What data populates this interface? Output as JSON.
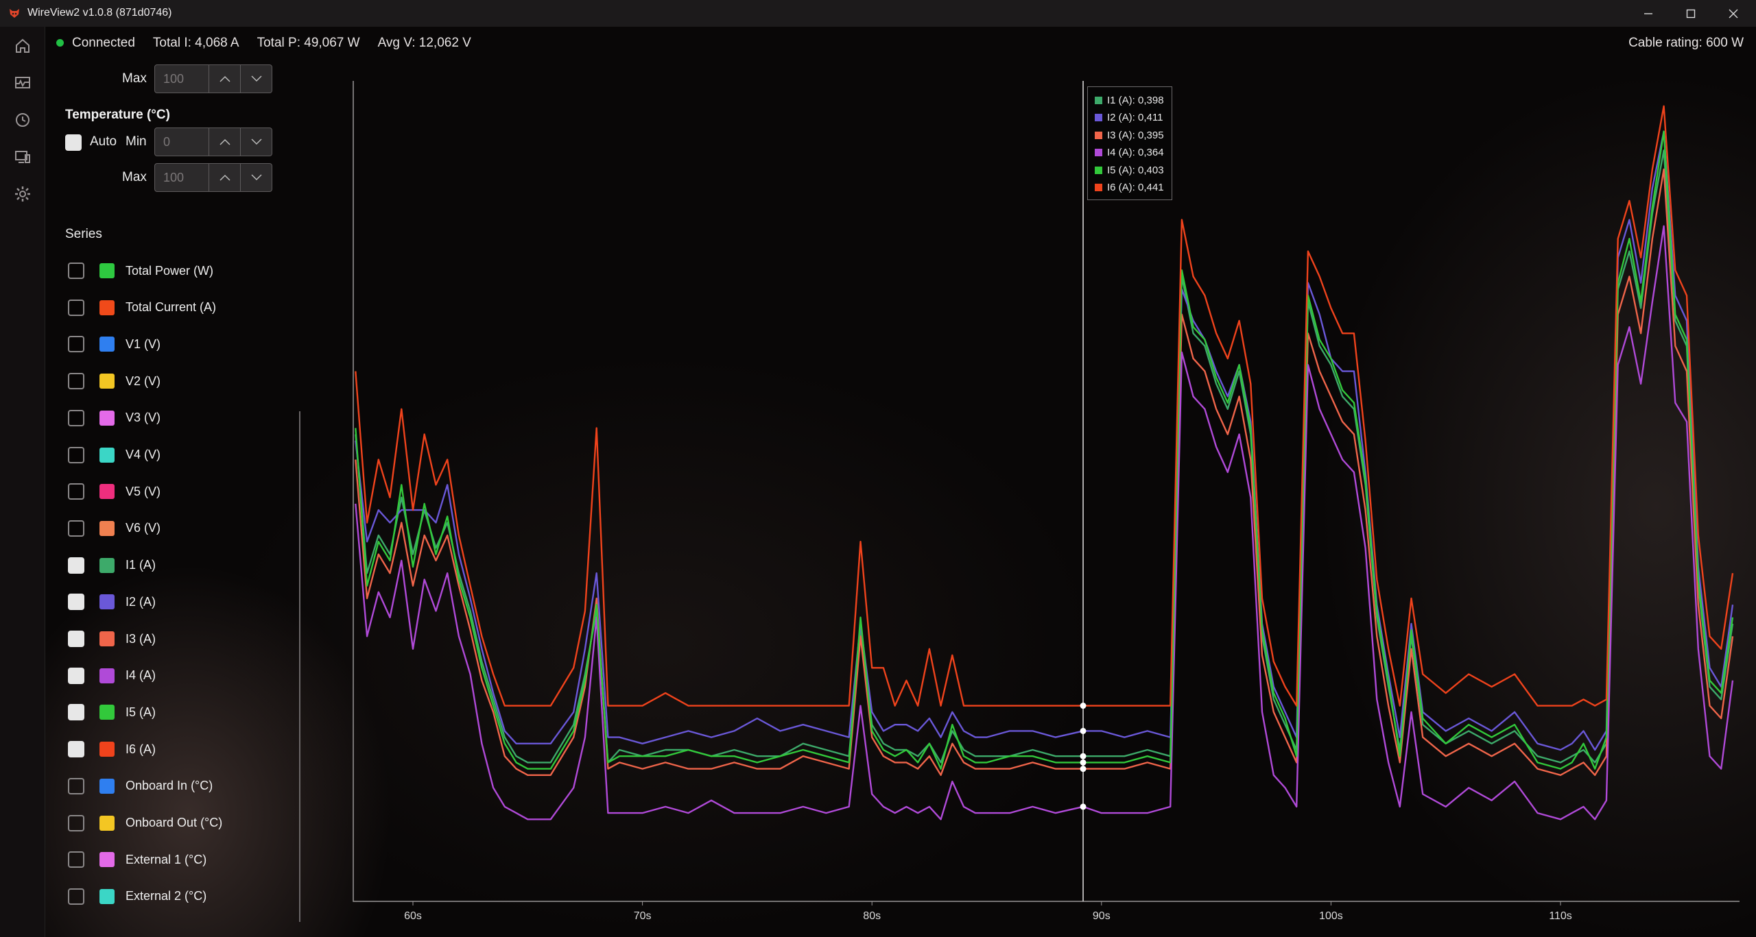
{
  "window": {
    "title": "WireView2 v1.0.8 (871d0746)"
  },
  "status": {
    "connection": "Connected",
    "total_current": "Total I: 4,068 A",
    "total_power": "Total P: 49,067 W",
    "avg_voltage": "Avg V: 12,062 V",
    "cable_rating": "Cable rating: 600 W"
  },
  "axis_controls": {
    "top_max_label": "Max",
    "top_max_value": "100",
    "temperature_title": "Temperature (°C)",
    "auto_label": "Auto",
    "min_label": "Min",
    "min_value": "0",
    "max_label": "Max",
    "max_value": "100"
  },
  "series_panel": {
    "title": "Series",
    "items": [
      {
        "label": "Total Power (W)",
        "color": "#2ec940",
        "checked": false
      },
      {
        "label": "Total Current (A)",
        "color": "#f04a1a",
        "checked": false
      },
      {
        "label": "V1 (V)",
        "color": "#2f7ff0",
        "checked": false
      },
      {
        "label": "V2 (V)",
        "color": "#f3c623",
        "checked": false
      },
      {
        "label": "V3 (V)",
        "color": "#e36ae8",
        "checked": false
      },
      {
        "label": "V4 (V)",
        "color": "#3bd6c6",
        "checked": false
      },
      {
        "label": "V5 (V)",
        "color": "#ef2e7e",
        "checked": false
      },
      {
        "label": "V6 (V)",
        "color": "#f08050",
        "checked": false
      },
      {
        "label": "I1 (A)",
        "color": "#3daa6a",
        "checked": true
      },
      {
        "label": "I2 (A)",
        "color": "#6a58d8",
        "checked": true
      },
      {
        "label": "I3 (A)",
        "color": "#f0654a",
        "checked": true
      },
      {
        "label": "I4 (A)",
        "color": "#b04ad8",
        "checked": true
      },
      {
        "label": "I5 (A)",
        "color": "#32c93b",
        "checked": true
      },
      {
        "label": "I6 (A)",
        "color": "#f0431c",
        "checked": true
      },
      {
        "label": "Onboard In (°C)",
        "color": "#2f7ff0",
        "checked": false
      },
      {
        "label": "Onboard Out (°C)",
        "color": "#f3c623",
        "checked": false
      },
      {
        "label": "External 1 (°C)",
        "color": "#e36ae8",
        "checked": false
      },
      {
        "label": "External 2 (°C)",
        "color": "#3bd6c6",
        "checked": false
      }
    ]
  },
  "tooltip": {
    "rows": [
      {
        "label": "I1 (A): 0,398",
        "color": "#3daa6a"
      },
      {
        "label": "I2 (A): 0,411",
        "color": "#6a58d8"
      },
      {
        "label": "I3 (A): 0,395",
        "color": "#f0654a"
      },
      {
        "label": "I4 (A): 0,364",
        "color": "#b04ad8"
      },
      {
        "label": "I5 (A): 0,403",
        "color": "#32c93b"
      },
      {
        "label": "I6 (A): 0,441",
        "color": "#f0431c"
      }
    ]
  },
  "chart_data": {
    "type": "line",
    "title": "",
    "xlabel": "",
    "ylabel": "",
    "x_ticks": [
      "60s",
      "70s",
      "80s",
      "90s",
      "100s",
      "110s"
    ],
    "xlim": [
      57.4,
      117.8
    ],
    "ylim": [
      0,
      1.3
    ],
    "cursor_x": 89.2,
    "x": [
      57.5,
      58.0,
      58.5,
      59.0,
      59.5,
      60.0,
      60.5,
      61.0,
      61.5,
      62.0,
      62.5,
      63.0,
      63.5,
      64.0,
      64.5,
      65.0,
      66.0,
      67.0,
      67.5,
      68.0,
      68.5,
      69.0,
      70.0,
      71.0,
      72.0,
      73.0,
      74.0,
      75.0,
      76.0,
      77.0,
      78.0,
      79.0,
      79.5,
      80.0,
      80.5,
      81.0,
      81.5,
      82.0,
      82.5,
      83.0,
      83.5,
      84.0,
      84.5,
      85.0,
      86.0,
      87.0,
      88.0,
      89.2,
      90.0,
      91.0,
      92.0,
      93.0,
      93.5,
      94.0,
      94.5,
      95.0,
      95.5,
      96.0,
      96.5,
      97.0,
      97.5,
      98.0,
      98.5,
      99.0,
      99.5,
      100.0,
      100.5,
      101.0,
      101.5,
      102.0,
      102.5,
      103.0,
      103.5,
      104.0,
      105.0,
      106.0,
      107.0,
      108.0,
      109.0,
      110.0,
      110.5,
      111.0,
      111.5,
      112.0,
      112.5,
      113.0,
      113.5,
      114.0,
      114.5,
      115.0,
      115.5,
      116.0,
      116.5,
      117.0,
      117.5
    ],
    "series": [
      {
        "name": "I1 (A)",
        "color": "#3daa6a",
        "values": [
          0.74,
          0.52,
          0.58,
          0.55,
          0.64,
          0.55,
          0.62,
          0.56,
          0.6,
          0.52,
          0.46,
          0.38,
          0.32,
          0.26,
          0.23,
          0.22,
          0.22,
          0.28,
          0.36,
          0.46,
          0.22,
          0.24,
          0.23,
          0.24,
          0.24,
          0.23,
          0.24,
          0.23,
          0.23,
          0.25,
          0.24,
          0.23,
          0.43,
          0.28,
          0.25,
          0.24,
          0.24,
          0.23,
          0.25,
          0.22,
          0.27,
          0.24,
          0.23,
          0.23,
          0.23,
          0.24,
          0.23,
          0.23,
          0.23,
          0.23,
          0.24,
          0.23,
          0.99,
          0.9,
          0.88,
          0.82,
          0.78,
          0.84,
          0.74,
          0.42,
          0.32,
          0.28,
          0.24,
          0.95,
          0.88,
          0.85,
          0.8,
          0.78,
          0.66,
          0.45,
          0.34,
          0.24,
          0.42,
          0.28,
          0.25,
          0.27,
          0.25,
          0.27,
          0.23,
          0.22,
          0.23,
          0.24,
          0.22,
          0.25,
          0.97,
          1.03,
          0.94,
          1.09,
          1.19,
          0.92,
          0.88,
          0.5,
          0.34,
          0.32,
          0.44
        ]
      },
      {
        "name": "I2 (A)",
        "color": "#6a58d8",
        "values": [
          0.73,
          0.57,
          0.62,
          0.6,
          0.62,
          0.62,
          0.62,
          0.6,
          0.66,
          0.55,
          0.48,
          0.4,
          0.33,
          0.27,
          0.25,
          0.25,
          0.25,
          0.3,
          0.4,
          0.52,
          0.26,
          0.26,
          0.25,
          0.26,
          0.27,
          0.26,
          0.27,
          0.29,
          0.27,
          0.28,
          0.27,
          0.26,
          0.44,
          0.3,
          0.27,
          0.28,
          0.28,
          0.27,
          0.29,
          0.26,
          0.3,
          0.27,
          0.26,
          0.26,
          0.27,
          0.27,
          0.26,
          0.27,
          0.27,
          0.26,
          0.27,
          0.26,
          0.97,
          0.92,
          0.89,
          0.84,
          0.8,
          0.85,
          0.76,
          0.44,
          0.34,
          0.3,
          0.26,
          0.98,
          0.93,
          0.86,
          0.84,
          0.84,
          0.68,
          0.47,
          0.36,
          0.26,
          0.44,
          0.3,
          0.27,
          0.29,
          0.27,
          0.3,
          0.25,
          0.24,
          0.25,
          0.27,
          0.24,
          0.27,
          1.02,
          1.08,
          0.98,
          1.13,
          1.22,
          0.96,
          0.92,
          0.53,
          0.37,
          0.34,
          0.47
        ]
      },
      {
        "name": "I3 (A)",
        "color": "#f0654a",
        "values": [
          0.7,
          0.48,
          0.55,
          0.52,
          0.6,
          0.5,
          0.58,
          0.54,
          0.58,
          0.5,
          0.43,
          0.35,
          0.3,
          0.23,
          0.21,
          0.2,
          0.2,
          0.26,
          0.34,
          0.48,
          0.21,
          0.22,
          0.21,
          0.22,
          0.21,
          0.21,
          0.22,
          0.21,
          0.21,
          0.23,
          0.22,
          0.21,
          0.42,
          0.26,
          0.23,
          0.22,
          0.22,
          0.21,
          0.23,
          0.2,
          0.25,
          0.22,
          0.21,
          0.21,
          0.21,
          0.22,
          0.21,
          0.21,
          0.21,
          0.21,
          0.22,
          0.21,
          0.93,
          0.86,
          0.84,
          0.78,
          0.74,
          0.8,
          0.7,
          0.39,
          0.3,
          0.26,
          0.22,
          0.9,
          0.84,
          0.8,
          0.76,
          0.74,
          0.62,
          0.42,
          0.31,
          0.22,
          0.4,
          0.26,
          0.23,
          0.25,
          0.23,
          0.25,
          0.21,
          0.2,
          0.21,
          0.22,
          0.2,
          0.23,
          0.93,
          0.99,
          0.9,
          1.05,
          1.16,
          0.88,
          0.84,
          0.47,
          0.31,
          0.29,
          0.42
        ]
      },
      {
        "name": "I4 (A)",
        "color": "#b04ad8",
        "values": [
          0.63,
          0.42,
          0.49,
          0.45,
          0.54,
          0.4,
          0.51,
          0.46,
          0.52,
          0.42,
          0.36,
          0.25,
          0.18,
          0.15,
          0.14,
          0.13,
          0.13,
          0.18,
          0.26,
          0.45,
          0.14,
          0.14,
          0.14,
          0.15,
          0.14,
          0.16,
          0.14,
          0.14,
          0.14,
          0.15,
          0.14,
          0.15,
          0.31,
          0.17,
          0.15,
          0.14,
          0.15,
          0.14,
          0.15,
          0.13,
          0.19,
          0.15,
          0.14,
          0.14,
          0.14,
          0.15,
          0.14,
          0.15,
          0.14,
          0.14,
          0.14,
          0.15,
          0.87,
          0.8,
          0.78,
          0.72,
          0.68,
          0.74,
          0.64,
          0.3,
          0.2,
          0.18,
          0.15,
          0.85,
          0.78,
          0.74,
          0.7,
          0.68,
          0.56,
          0.32,
          0.22,
          0.15,
          0.3,
          0.17,
          0.15,
          0.18,
          0.16,
          0.19,
          0.14,
          0.13,
          0.14,
          0.15,
          0.13,
          0.16,
          0.85,
          0.91,
          0.82,
          0.95,
          1.07,
          0.79,
          0.76,
          0.4,
          0.23,
          0.21,
          0.35
        ]
      },
      {
        "name": "I5 (A)",
        "color": "#32c93b",
        "values": [
          0.75,
          0.5,
          0.57,
          0.54,
          0.66,
          0.53,
          0.63,
          0.55,
          0.61,
          0.51,
          0.45,
          0.37,
          0.31,
          0.25,
          0.22,
          0.21,
          0.21,
          0.27,
          0.35,
          0.47,
          0.22,
          0.23,
          0.23,
          0.23,
          0.24,
          0.23,
          0.23,
          0.22,
          0.23,
          0.24,
          0.23,
          0.22,
          0.45,
          0.27,
          0.24,
          0.23,
          0.24,
          0.22,
          0.25,
          0.21,
          0.28,
          0.23,
          0.22,
          0.22,
          0.23,
          0.23,
          0.22,
          0.22,
          0.22,
          0.22,
          0.23,
          0.22,
          1.0,
          0.91,
          0.89,
          0.83,
          0.79,
          0.85,
          0.75,
          0.43,
          0.33,
          0.29,
          0.23,
          0.96,
          0.89,
          0.86,
          0.81,
          0.79,
          0.67,
          0.46,
          0.35,
          0.23,
          0.43,
          0.29,
          0.25,
          0.28,
          0.26,
          0.28,
          0.22,
          0.21,
          0.22,
          0.25,
          0.21,
          0.26,
          0.98,
          1.05,
          0.95,
          1.1,
          1.22,
          0.93,
          0.89,
          0.51,
          0.35,
          0.33,
          0.45
        ]
      },
      {
        "name": "I6 (A)",
        "color": "#f0431c",
        "values": [
          0.84,
          0.6,
          0.7,
          0.64,
          0.78,
          0.62,
          0.74,
          0.66,
          0.7,
          0.58,
          0.5,
          0.42,
          0.36,
          0.31,
          0.31,
          0.31,
          0.31,
          0.37,
          0.46,
          0.75,
          0.31,
          0.31,
          0.31,
          0.33,
          0.31,
          0.31,
          0.31,
          0.31,
          0.31,
          0.31,
          0.31,
          0.31,
          0.57,
          0.37,
          0.37,
          0.31,
          0.35,
          0.31,
          0.4,
          0.31,
          0.39,
          0.31,
          0.31,
          0.31,
          0.31,
          0.31,
          0.31,
          0.31,
          0.31,
          0.31,
          0.31,
          0.31,
          1.08,
          0.99,
          0.96,
          0.9,
          0.86,
          0.92,
          0.82,
          0.48,
          0.38,
          0.34,
          0.31,
          1.03,
          0.99,
          0.94,
          0.9,
          0.9,
          0.73,
          0.51,
          0.4,
          0.31,
          0.48,
          0.36,
          0.33,
          0.36,
          0.34,
          0.36,
          0.31,
          0.31,
          0.31,
          0.32,
          0.31,
          0.32,
          1.05,
          1.11,
          1.02,
          1.16,
          1.26,
          1.0,
          0.96,
          0.58,
          0.42,
          0.4,
          0.52
        ]
      }
    ]
  }
}
